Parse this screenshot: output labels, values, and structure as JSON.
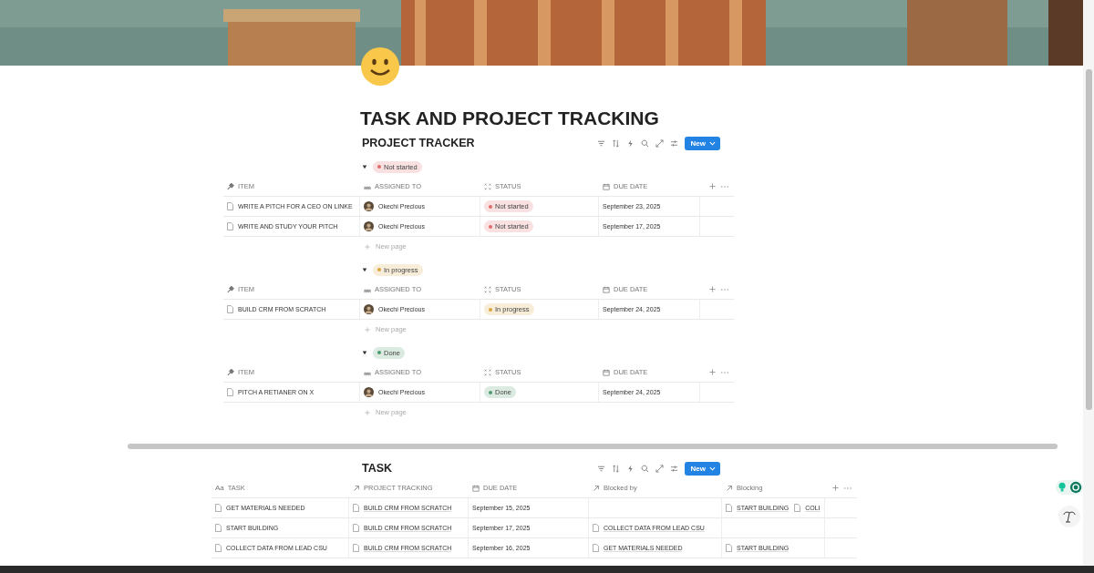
{
  "title": "TASK AND PROJECT TRACKING",
  "project_tracker": {
    "title": "PROJECT TRACKER",
    "new_button": "New",
    "groups": [
      {
        "label": "Not started",
        "color": "#e16b6b",
        "expanded": true,
        "new_page": "New page",
        "columns": [
          {
            "label": "ITEM",
            "kind": "title"
          },
          {
            "label": "ASSIGNED TO",
            "kind": "person"
          },
          {
            "label": "STATUS",
            "kind": "status"
          },
          {
            "label": "DUE DATE",
            "kind": "date"
          }
        ],
        "rows": [
          {
            "item": "WRITE A PITCH FOR A CEO ON LINKE",
            "assignee": "Okechi Precious",
            "status": {
              "label": "Not started",
              "color": "#e16b6b"
            },
            "due": "September 23, 2025"
          },
          {
            "item": "WRITE AND STUDY YOUR PITCH",
            "assignee": "Okechi Precious",
            "status": {
              "label": "Not started",
              "color": "#e16b6b"
            },
            "due": "September 17, 2025"
          }
        ]
      },
      {
        "label": "In progress",
        "color": "#d9a53c",
        "expanded": true,
        "new_page": "New page",
        "columns": [
          {
            "label": "ITEM",
            "kind": "title"
          },
          {
            "label": "ASSIGNED TO",
            "kind": "person"
          },
          {
            "label": "STATUS",
            "kind": "status"
          },
          {
            "label": "DUE DATE",
            "kind": "date"
          }
        ],
        "rows": [
          {
            "item": "BUILD CRM FROM SCRATCH",
            "assignee": "Okechi Precious",
            "status": {
              "label": "In progress",
              "color": "#d9a53c"
            },
            "due": "September 24, 2025"
          }
        ]
      },
      {
        "label": "Done",
        "color": "#4d9c6d",
        "expanded": true,
        "new_page": "New page",
        "columns": [
          {
            "label": "ITEM",
            "kind": "title"
          },
          {
            "label": "ASSIGNED TO",
            "kind": "person"
          },
          {
            "label": "STATUS",
            "kind": "status"
          },
          {
            "label": "DUE DATE",
            "kind": "date"
          }
        ],
        "rows": [
          {
            "item": "PITCH A RETIANER ON X",
            "assignee": "Okechi Precious",
            "status": {
              "label": "Done",
              "color": "#4d9c6d"
            },
            "due": "September 24, 2025"
          }
        ]
      }
    ]
  },
  "task": {
    "title": "TASK",
    "new_button": "New",
    "columns": [
      {
        "label": "TASK",
        "kind": "title",
        "icon": "Aa"
      },
      {
        "label": "PROJECT TRACKING",
        "kind": "relation"
      },
      {
        "label": "DUE DATE",
        "kind": "date"
      },
      {
        "label": "Blocked by",
        "kind": "relation"
      },
      {
        "label": "Blocking",
        "kind": "relation"
      }
    ],
    "rows": [
      {
        "task": "GET MATERIALS NEEDED",
        "project": [
          "BUILD CRM FROM SCRATCH"
        ],
        "due": "September 15, 2025",
        "blocked_by": [],
        "blocking": [
          "START BUILDING",
          "COLI"
        ]
      },
      {
        "task": "START BUILDING",
        "project": [
          "BUILD CRM FROM SCRATCH"
        ],
        "due": "September 17, 2025",
        "blocked_by": [
          "COLLECT DATA FROM LEAD CSU"
        ],
        "blocking": []
      },
      {
        "task": "COLLECT DATA FROM LEAD CSU",
        "project": [
          "BUILD CRM FROM SCRATCH"
        ],
        "due": "September 16, 2025",
        "blocked_by": [
          "GET MATERIALS NEEDED"
        ],
        "blocking": [
          "START BUILDING"
        ]
      }
    ]
  }
}
